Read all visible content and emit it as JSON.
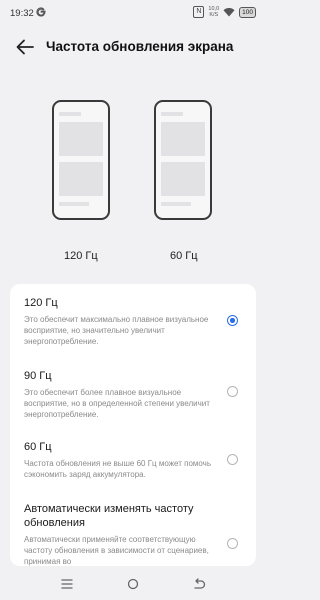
{
  "status_bar": {
    "time": "19:32",
    "google_icon": "google-g-icon",
    "nfc_icon": "nfc-icon",
    "nfc_label": "N",
    "net_speed_value": "10,0",
    "net_speed_unit": "K/S",
    "wifi_icon": "wifi-icon",
    "battery_level": "100"
  },
  "header": {
    "back_icon": "arrow-left-icon",
    "title": "Частота обновления экрана"
  },
  "previews": [
    {
      "label": "120 Гц"
    },
    {
      "label": "60 Гц"
    }
  ],
  "options": [
    {
      "title": "120 Гц",
      "description": "Это обеспечит максимально плавное визуальное восприятие, но значительно увеличит энергопотребление.",
      "selected": true
    },
    {
      "title": "90 Гц",
      "description": "Это обеспечит более плавное визуальное восприятие, но в определенной степени увеличит энергопотребление.",
      "selected": false
    },
    {
      "title": "60 Гц",
      "description": "Частота обновления не выше 60 Гц может помочь сэкономить заряд аккумулятора.",
      "selected": false
    },
    {
      "title": "Автоматически изменять частоту обновления",
      "description": "Автоматически применяйте соответствующую частоту обновления в зависимости от сценариев, принимая во",
      "selected": false
    }
  ],
  "colors": {
    "accent": "#2a6ee8",
    "background": "#f1f1f3",
    "card": "#ffffff",
    "secondary_text": "#8a8a8a"
  },
  "nav_bar": {
    "menu_icon": "menu-lines-icon",
    "home_icon": "home-circle-icon",
    "back_icon": "back-curve-icon"
  }
}
